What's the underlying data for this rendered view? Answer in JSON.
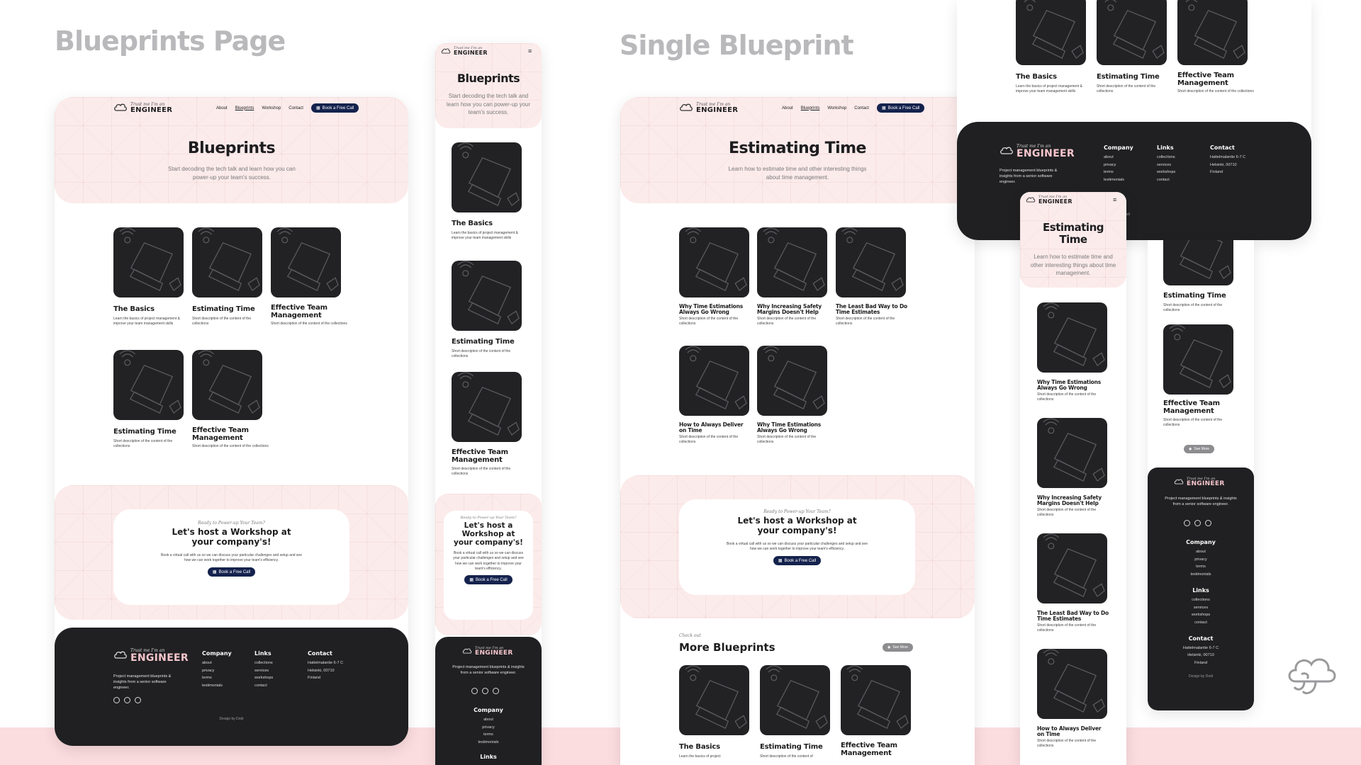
{
  "labels": {
    "blueprints_page": "Blueprints Page",
    "single_blueprint": "Single Blueprint"
  },
  "brand": {
    "logo_small": "Trust me I'm an",
    "logo_big": "ENGINEER"
  },
  "nav": {
    "about": "About",
    "blueprints": "Blueprints",
    "workshop": "Workshop",
    "contact": "Contact",
    "book": "Book a Free Call"
  },
  "blueprints": {
    "title": "Blueprints",
    "subtitle": "Start decoding the tech talk and learn how you can power-up your team's success.",
    "cards": [
      {
        "title": "The Basics",
        "desc": "Learn the basics of project management & improve your team management skills"
      },
      {
        "title": "Estimating Time",
        "desc": "Short description of the content of the collections"
      },
      {
        "title": "Effective Team Management",
        "desc": "Short description of the content of the collections"
      },
      {
        "title": "Estimating Time",
        "desc": "Short description of the content of the collections"
      },
      {
        "title": "Effective Team Management",
        "desc": "Short description of the content of the collections"
      }
    ]
  },
  "single": {
    "title": "Estimating Time",
    "subtitle": "Learn how to estimate time and other interesting things about time management.",
    "cards": [
      {
        "title": "Why Time Estimations Always Go Wrong",
        "desc": "Short description of the content of the collections"
      },
      {
        "title": "Why Increasing Safety Margins Doesn't Help",
        "desc": "Short description of the content of the collections"
      },
      {
        "title": "The Least Bad Way to Do Time Estimates",
        "desc": "Short description of the content of the collections"
      },
      {
        "title": "How to Always Deliver on Time",
        "desc": "Short description of the content of the collections"
      },
      {
        "title": "Why Time Estimations Always Go Wrong",
        "desc": "Short description of the content of the collections"
      }
    ],
    "more_script": "Check out",
    "more_title": "More Blueprints",
    "see_more": "See More",
    "more_cards": [
      {
        "title": "The Basics",
        "desc": "Learn the basics of project"
      },
      {
        "title": "Estimating Time",
        "desc": "Short description of the content of"
      },
      {
        "title": "Effective Team Management",
        "desc": ""
      }
    ]
  },
  "cta": {
    "script": "Ready to Power-up Your Team?",
    "title": "Let's host a Workshop at your company's!",
    "desc": "Book a virtual call with us so we can discuss your particular challenges and setup and see how we can work together to improve your team's efficiency.",
    "button": "Book a Free Call"
  },
  "footer": {
    "tagline": "Project management blueprints & insights from a senior software engineer.",
    "company_h": "Company",
    "company": [
      "about",
      "privacy",
      "terms",
      "testimonials"
    ],
    "links_h": "Links",
    "links": [
      "collections",
      "services",
      "workshops",
      "contact"
    ],
    "contact_h": "Contact",
    "contact": [
      "Hattelmalantie 6-7 C",
      "Helsinki, 00710",
      "Finland"
    ],
    "credit": "Design by Dodi"
  }
}
